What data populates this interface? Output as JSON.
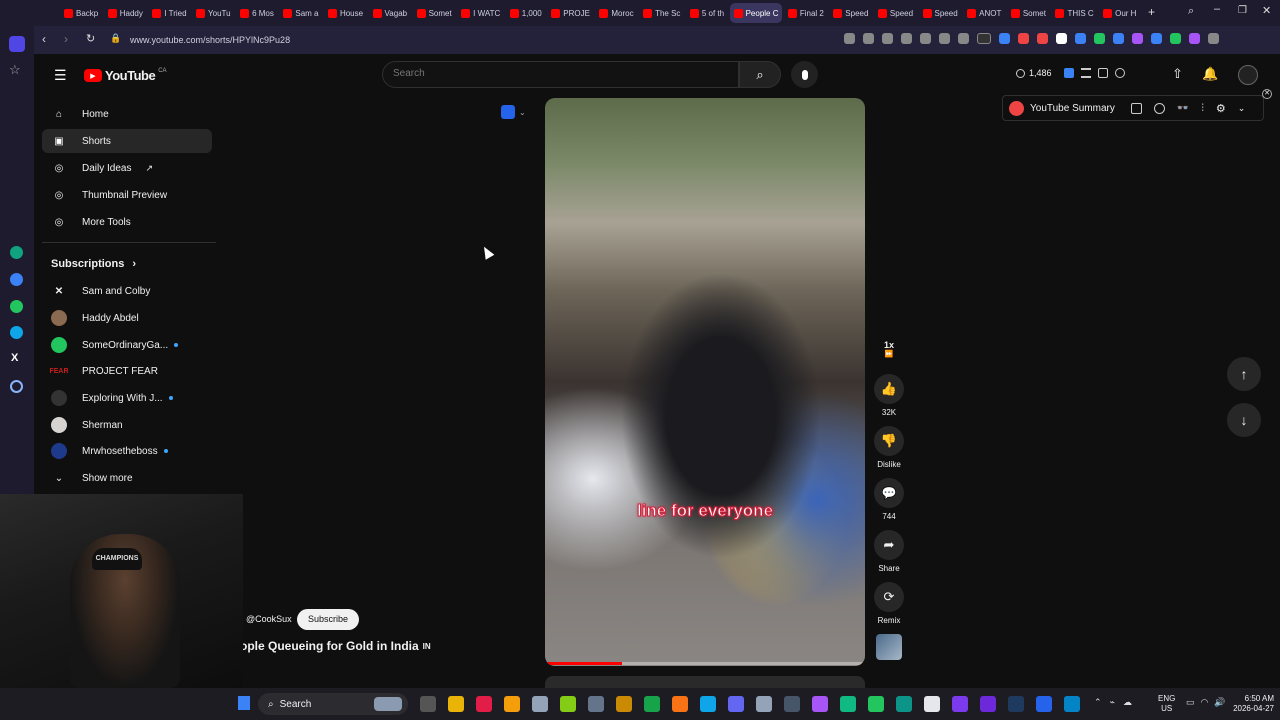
{
  "browser": {
    "tabs": [
      "Backp",
      "Haddy",
      "I Tried",
      "YouTu",
      "6 Mos",
      "Sam a",
      "House",
      "Vagab",
      "Somet",
      "I WATC",
      "1,000",
      "PROJE",
      "Moroc",
      "The Sc",
      "5 of th",
      "People C",
      "Final 2",
      "Speed",
      "Speed",
      "Speed",
      "ANOT",
      "Somet",
      "THIS C",
      "Our H"
    ],
    "active_tab_index": 15,
    "url": "www.youtube.com/shorts/HPYlNc9Pu28"
  },
  "youtube": {
    "logo_text": "YouTube",
    "region": "CA",
    "search_placeholder": "Search",
    "counter": "1,486",
    "summary_label": "YouTube Summary",
    "sidebar": {
      "items": [
        {
          "label": "Home",
          "icon": "home-icon"
        },
        {
          "label": "Shorts",
          "icon": "shorts-icon"
        },
        {
          "label": "Daily Ideas",
          "icon": "tubebuddy-icon"
        },
        {
          "label": "Thumbnail Preview",
          "icon": "tubebuddy-icon"
        },
        {
          "label": "More Tools",
          "icon": "tubebuddy-icon"
        }
      ],
      "subscriptions_label": "Subscriptions",
      "subscriptions": [
        "Sam and Colby",
        "Haddy Abdel",
        "SomeOrdinaryGa...",
        "PROJECT FEAR",
        "Exploring With J...",
        "Sherman",
        "Mrwhosetheboss"
      ],
      "show_more": "Show more"
    },
    "short": {
      "caption": "line for everyone",
      "channel": "@CookSux",
      "subscribe": "Subscribe",
      "title": "ople Queueing for Gold in India",
      "flag_text": "IN",
      "progress": 0.24
    },
    "actions": {
      "speed": "1x",
      "likes": "32K",
      "dislike": "Dislike",
      "comments": "744",
      "share": "Share",
      "remix": "Remix"
    }
  },
  "taskbar": {
    "search": "Search",
    "lang_top": "ENG",
    "lang_bottom": "US",
    "time": "6:50 AM",
    "date": "2026-04-27"
  }
}
